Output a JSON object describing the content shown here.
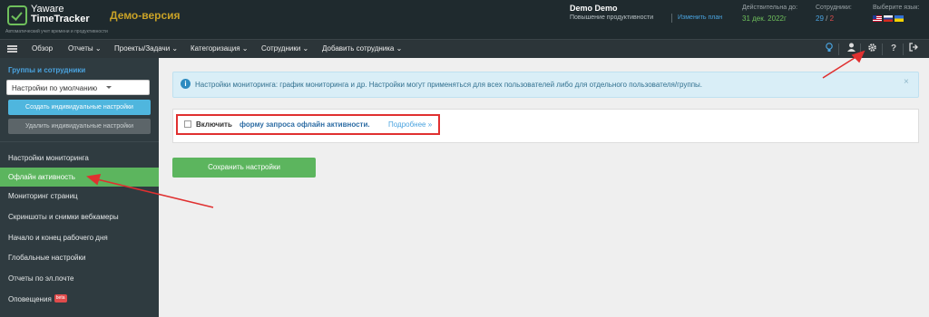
{
  "brand": {
    "name_line1": "Yaware",
    "name_line2": "TimeTracker",
    "tagline": "Автоматический учет времени и продуктивности",
    "demo_label": "Демо-версия"
  },
  "header": {
    "user_name": "Demo Demo",
    "user_subtitle": "Повышение продуктивности",
    "change_plan": "Изменить план",
    "valid_until_label": "Действительна до:",
    "valid_until_value": "31 дек. 2022г",
    "employees_label": "Сотрудники:",
    "employees_count": "29",
    "employees_sep": "/",
    "employees_limit": "2",
    "language_label": "Выберите язык:",
    "languages": [
      "en-flag",
      "ru-flag",
      "ua-flag"
    ]
  },
  "nav": {
    "menu_icon": "hamburger-icon",
    "items": [
      {
        "label": "Обзор"
      },
      {
        "label": "Отчеты ⌄"
      },
      {
        "label": "Проекты/Задачи ⌄"
      },
      {
        "label": "Категоризация ⌄"
      },
      {
        "label": "Сотрудники ⌄"
      },
      {
        "label": "Добавить сотрудника ⌄"
      }
    ],
    "right_icons": [
      "lightbulb-icon",
      "user-icon",
      "gear-icon",
      "help-icon",
      "logout-icon"
    ]
  },
  "sidebar": {
    "title": "Группы и сотрудники",
    "select_value": "Настройки по умолчанию",
    "create_button": "Создать индивидуальные настройки",
    "delete_button": "Удалить индивидуальные настройки",
    "items": [
      {
        "label": "Настройки мониторинга"
      },
      {
        "label": "Офлайн активность",
        "active": true
      },
      {
        "label": "Мониторинг страниц"
      },
      {
        "label": "Скриншоты и снимки вебкамеры"
      },
      {
        "label": "Начало и конец рабочего дня"
      },
      {
        "label": "Глобальные настройки"
      },
      {
        "label": "Отчеты по эл.почте"
      },
      {
        "label": "Оповещения",
        "badge": "beta"
      }
    ]
  },
  "main": {
    "info_text": "Настройки мониторинга: график мониторинга и др. Настройки могут применяться для всех пользователей либо для отдельного пользователя/группы.",
    "info_close": "×",
    "enable_label": "Включить",
    "enable_link": "форму запроса офлайн активности.",
    "more_link": "Подробнее »",
    "save_button": "Сохранить настройки"
  },
  "colors": {
    "header_bg": "#1f2a2e",
    "sidebar_bg": "#2f3b40",
    "accent_green": "#5cb55e",
    "accent_blue": "#4aa3df",
    "annotation_red": "#e03030"
  }
}
